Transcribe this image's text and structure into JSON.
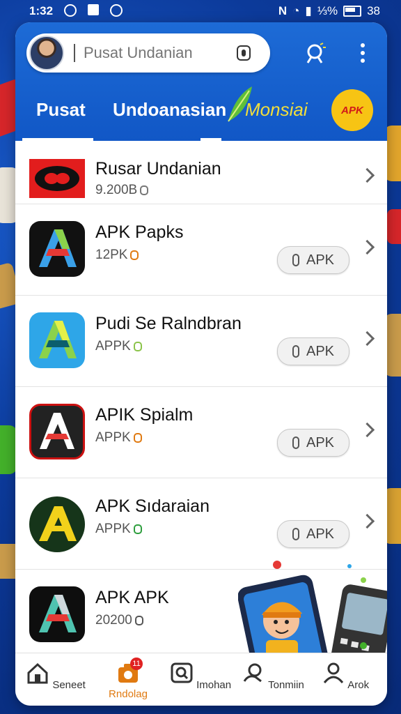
{
  "status_bar": {
    "time": "1:32",
    "battery_text": "⅓%",
    "extra": "38"
  },
  "search": {
    "placeholder": "Pusat Undanian"
  },
  "tabs": [
    {
      "label": "Pusat"
    },
    {
      "label": "Undoanasian"
    },
    {
      "label": "Monsiai"
    }
  ],
  "badge": "APK",
  "list": [
    {
      "title": "Rusar Undanian",
      "sub": "9.200B",
      "dot_color": "#777777",
      "button": ""
    },
    {
      "title": "APK Papks",
      "sub": "12PK",
      "dot_color": "#e07a11",
      "button": "APK"
    },
    {
      "title": "Pudi Se Ralndbran",
      "sub": "APPK",
      "dot_color": "#8bc34a",
      "button": "APK"
    },
    {
      "title": "APIK Spialm",
      "sub": "APPK",
      "dot_color": "#e07a11",
      "button": "APK"
    },
    {
      "title": "APK Sıdaraian",
      "sub": "APPK",
      "dot_color": "#2e9e3e",
      "button": "APK"
    },
    {
      "title": "APK APK",
      "sub": "20200",
      "dot_color": "#555555",
      "button": ""
    }
  ],
  "bottom_nav": [
    {
      "label": "Seneet",
      "icon": "home-icon"
    },
    {
      "label": "Rndolag",
      "icon": "camera-icon",
      "badge": "11",
      "active": true
    },
    {
      "label": "Imohan",
      "icon": "search-icon"
    },
    {
      "label": "Tonmiin",
      "icon": "chat-icon"
    },
    {
      "label": "Arok",
      "icon": "profile-icon"
    }
  ]
}
